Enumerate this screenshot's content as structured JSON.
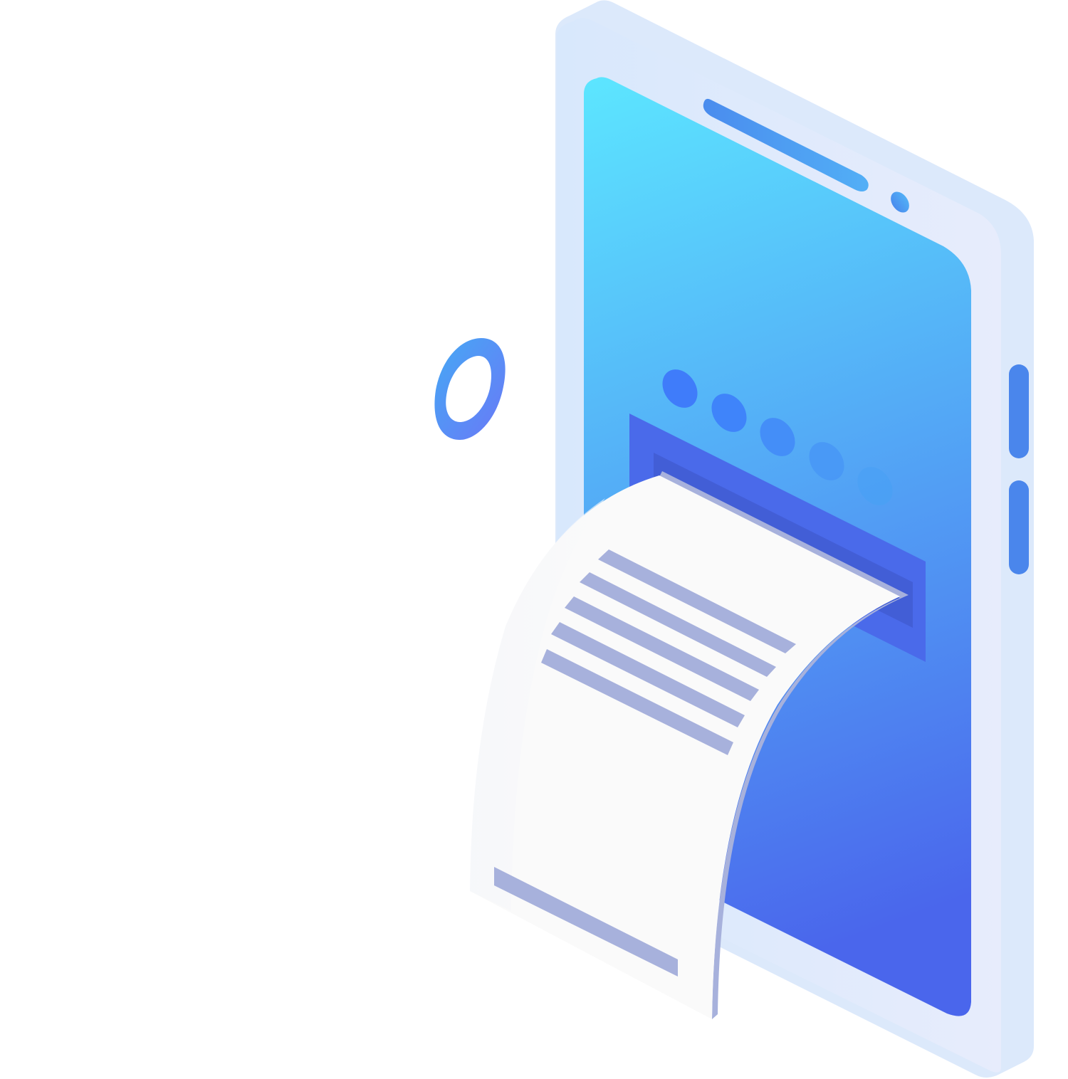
{
  "illustration": {
    "subject": "phone-receipt",
    "colors": {
      "phone_body": "#dce9fb",
      "phone_body_light": "#e8eefc",
      "screen_top": "#5ce6ff",
      "screen_bottom": "#4a66ec",
      "slot_outer": "#4a6aea",
      "slot_inner": "#425ed6",
      "speaker": "#4f9cf2",
      "side_buttons": "#4a86ec",
      "dot": "#3f7cfa",
      "paper": "#fafafa",
      "paper_edge": "#a7b1dc",
      "paper_lines": "#a7b1dc",
      "ring_start": "#45a9f4",
      "ring_end": "#6a78f7"
    },
    "icons": [
      "phone-icon",
      "receipt-icon",
      "ring-icon"
    ],
    "progress_dots": {
      "count": 5
    },
    "receipt_lines": {
      "top_group": 5,
      "bottom_group": 1
    }
  }
}
